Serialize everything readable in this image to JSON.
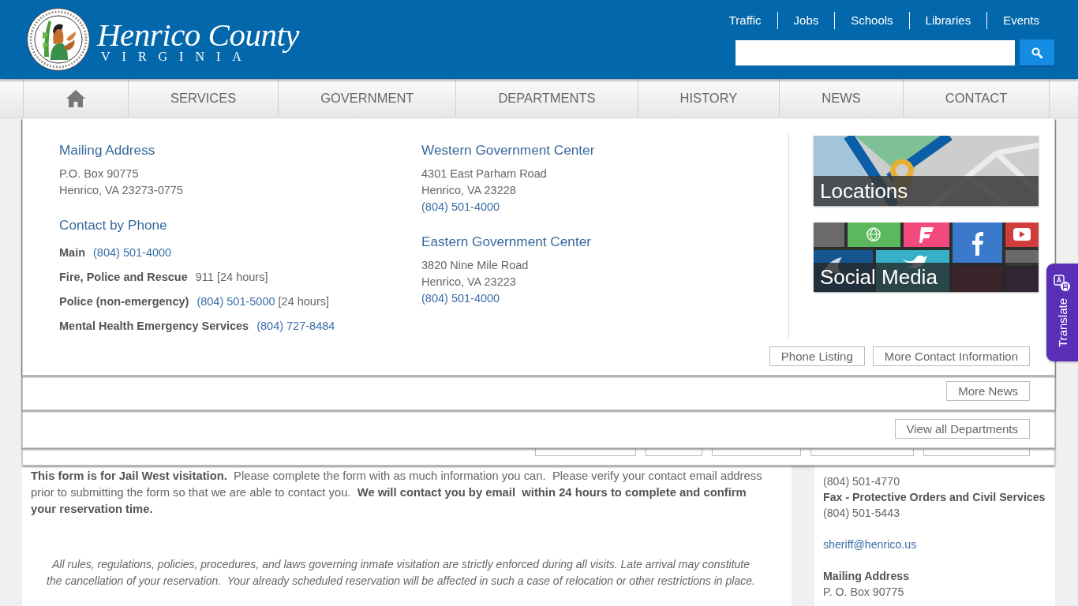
{
  "header": {
    "logo": {
      "title": "Henrico County",
      "subtitle": "VIRGINIA"
    },
    "top_links": [
      "Traffic",
      "Jobs",
      "Schools",
      "Libraries",
      "Events"
    ]
  },
  "nav": {
    "items": [
      {
        "kind": "home"
      },
      {
        "kind": "text",
        "label": "SERVICES"
      },
      {
        "kind": "text",
        "label": "GOVERNMENT"
      },
      {
        "kind": "text",
        "label": "DEPARTMENTS"
      },
      {
        "kind": "text",
        "label": "HISTORY"
      },
      {
        "kind": "text",
        "label": "NEWS"
      },
      {
        "kind": "text",
        "label": "CONTACT"
      }
    ]
  },
  "contact_panel": {
    "columns": [
      {
        "sections": [
          {
            "heading": "Mailing Address",
            "lines": [
              {
                "text": "P.O. Box 90775",
                "kind": "plain"
              },
              {
                "text": "Henrico, VA 23273-0775",
                "kind": "plain"
              }
            ]
          },
          {
            "heading": "Contact by Phone",
            "rows": [
              {
                "label": "Main",
                "parts": [
                  {
                    "text": "(804) 501-4000",
                    "kind": "link"
                  }
                ]
              },
              {
                "label": "Fire, Police and Rescue",
                "parts": [
                  {
                    "text": "911 [24 hours]",
                    "kind": "plain"
                  }
                ]
              },
              {
                "label": "Police (non-emergency)",
                "parts": [
                  {
                    "text": "(804) 501-5000",
                    "kind": "link"
                  },
                  {
                    "text": "[24 hours]",
                    "kind": "plain"
                  }
                ]
              },
              {
                "label": "Mental Health Emergency Services",
                "parts": [
                  {
                    "text": "(804) 727-8484",
                    "kind": "link"
                  }
                ]
              }
            ]
          }
        ]
      },
      {
        "sections": [
          {
            "heading": "Western Government Center",
            "lines": [
              {
                "text": "4301 East Parham Road",
                "kind": "plain"
              },
              {
                "text": "Henrico, VA 23228",
                "kind": "plain"
              },
              {
                "text": "(804) 501-4000",
                "kind": "link"
              }
            ]
          },
          {
            "heading": "Eastern Government Center",
            "lines": [
              {
                "text": "3820 Nine Mile Road",
                "kind": "plain"
              },
              {
                "text": "Henrico, VA 23223",
                "kind": "plain"
              },
              {
                "text": "(804) 501-4000",
                "kind": "link"
              }
            ]
          }
        ]
      }
    ],
    "tiles": [
      {
        "label": "Locations",
        "kind": "map"
      },
      {
        "label": "Social Media",
        "kind": "social"
      }
    ],
    "buttons": [
      "Phone Listing",
      "More Contact Information"
    ]
  },
  "news_panel": {
    "buttons": [
      "More News"
    ]
  },
  "departments_panel": {
    "buttons": [
      "View all Departments"
    ]
  },
  "services_panel": {
    "buttons": [
      {
        "kind": "covered"
      },
      {
        "kind": "covered"
      },
      {
        "kind": "covered"
      },
      {
        "kind": "covered"
      },
      {
        "kind": "covered"
      }
    ]
  },
  "content": {
    "intro": "**This form is for Jail West visitation.**  Please complete the form with as much information you can.  Please verify your contact email address prior to submitting the form so that we are able to contact you.  **We will contact you by email  within 24 hours to complete and confirm your reservation time.**",
    "notice": "All rules, regulations, policies, procedures, and laws governing inmate visitation are strictly enforced during all visits. Late arrival may constitute the cancellation of your reservation.  Your already scheduled reservation will be affected in such a case of relocation or other restrictions in place."
  },
  "sidebar": {
    "groups": [
      {
        "lines": [
          {
            "text": "(804) 501-4770",
            "kind": "plain"
          },
          {
            "text": "Fax - Protective Orders and Civil Services",
            "kind": "label"
          },
          {
            "text": "(804) 501-5443",
            "kind": "plain"
          }
        ]
      },
      {
        "lines": [
          {
            "text": "sheriff@henrico.us",
            "kind": "link"
          }
        ]
      },
      {
        "lines": [
          {
            "text": "Mailing Address",
            "kind": "label"
          },
          {
            "text": "P. O. Box 90775",
            "kind": "plain"
          }
        ]
      }
    ]
  },
  "translate_tab": {
    "label": "Translate"
  }
}
